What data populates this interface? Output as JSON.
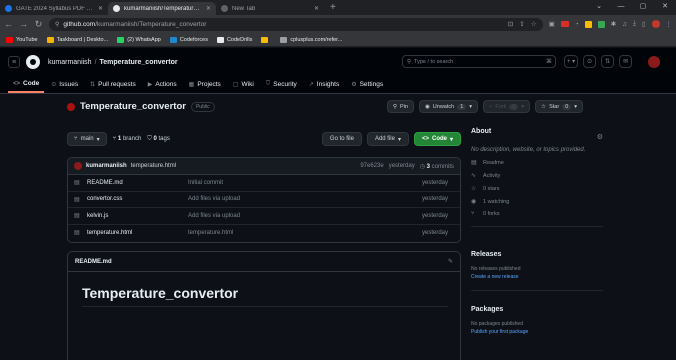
{
  "browser": {
    "tabs": [
      {
        "title": "GATE 2024 Syllabus PDF Out: Do",
        "fav_color": "#1a73e8"
      },
      {
        "title": "kumarmaniish/Temperature_conv",
        "fav_color": "#e8eaed"
      },
      {
        "title": "New Tab",
        "fav_color": "#9aa0a6"
      }
    ],
    "url_host": "github.com",
    "url_path": "/kumarmaniish/Temperature_convertor",
    "bookmarks": [
      {
        "label": "YouTube",
        "color": "#ff0000"
      },
      {
        "label": "Taskboard | Deskto...",
        "color": "#f4b400"
      },
      {
        "label": "(2) WhatsApp",
        "color": "#25d366"
      },
      {
        "label": "Codeforces",
        "color": "#1f8acb"
      },
      {
        "label": "CodeDrills",
        "color": "#e8eaed"
      },
      {
        "label": "",
        "color": "#fbbc04"
      },
      {
        "label": "cplusplus.com/refer...",
        "color": "#9aa0a6"
      }
    ]
  },
  "header": {
    "owner": "kumarmaniish",
    "repo": "Temperature_convertor",
    "search_placeholder": "Type / to search",
    "search_kbd": "/"
  },
  "repo_nav": [
    {
      "label": "Code",
      "icon": "<>"
    },
    {
      "label": "Issues",
      "icon": "⊙"
    },
    {
      "label": "Pull requests",
      "icon": "⇅"
    },
    {
      "label": "Actions",
      "icon": "▶"
    },
    {
      "label": "Projects",
      "icon": "▦"
    },
    {
      "label": "Wiki",
      "icon": "▢"
    },
    {
      "label": "Security",
      "icon": "⛉"
    },
    {
      "label": "Insights",
      "icon": "↗"
    },
    {
      "label": "Settings",
      "icon": "⚙"
    }
  ],
  "repo": {
    "name": "Temperature_convertor",
    "visibility": "Public",
    "pin": "Pin",
    "unwatch": "Unwatch",
    "unwatch_count": "1",
    "fork": "Fork",
    "fork_count": "0",
    "star": "Star",
    "star_count": "0"
  },
  "branchbar": {
    "branch": "main",
    "branch_count": "1",
    "branch_word": "branch",
    "tag_count": "0",
    "tag_word": "tags",
    "goto": "Go to file",
    "add": "Add file",
    "code": "Code"
  },
  "commit": {
    "user": "kumarmaniish",
    "message": "temperature.html",
    "hash": "97e623e",
    "when": "yesterday",
    "count": "3",
    "count_word": "commits"
  },
  "files": [
    {
      "name": "README.md",
      "msg": "Initial commit",
      "date": "yesterday"
    },
    {
      "name": "convertor.css",
      "msg": "Add files via upload",
      "date": "yesterday"
    },
    {
      "name": "kelvin.js",
      "msg": "Add files via upload",
      "date": "yesterday"
    },
    {
      "name": "temperature.html",
      "msg": "temperature.html",
      "date": "yesterday"
    }
  ],
  "readme": {
    "file": "README.md",
    "heading": "Temperature_convertor"
  },
  "about": {
    "title": "About",
    "desc": "No description, website, or topics provided.",
    "items": [
      {
        "icon": "▤",
        "label": "Readme"
      },
      {
        "icon": "∿",
        "label": "Activity"
      },
      {
        "icon": "☆",
        "label": "0 stars"
      },
      {
        "icon": "◉",
        "label": "1 watching"
      },
      {
        "icon": "⑂",
        "label": "0 forks"
      }
    ]
  },
  "releases": {
    "title": "Releases",
    "none": "No releases published",
    "link": "Create a new release"
  },
  "packages": {
    "title": "Packages",
    "none": "No packages published",
    "link": "Publish your first package"
  }
}
